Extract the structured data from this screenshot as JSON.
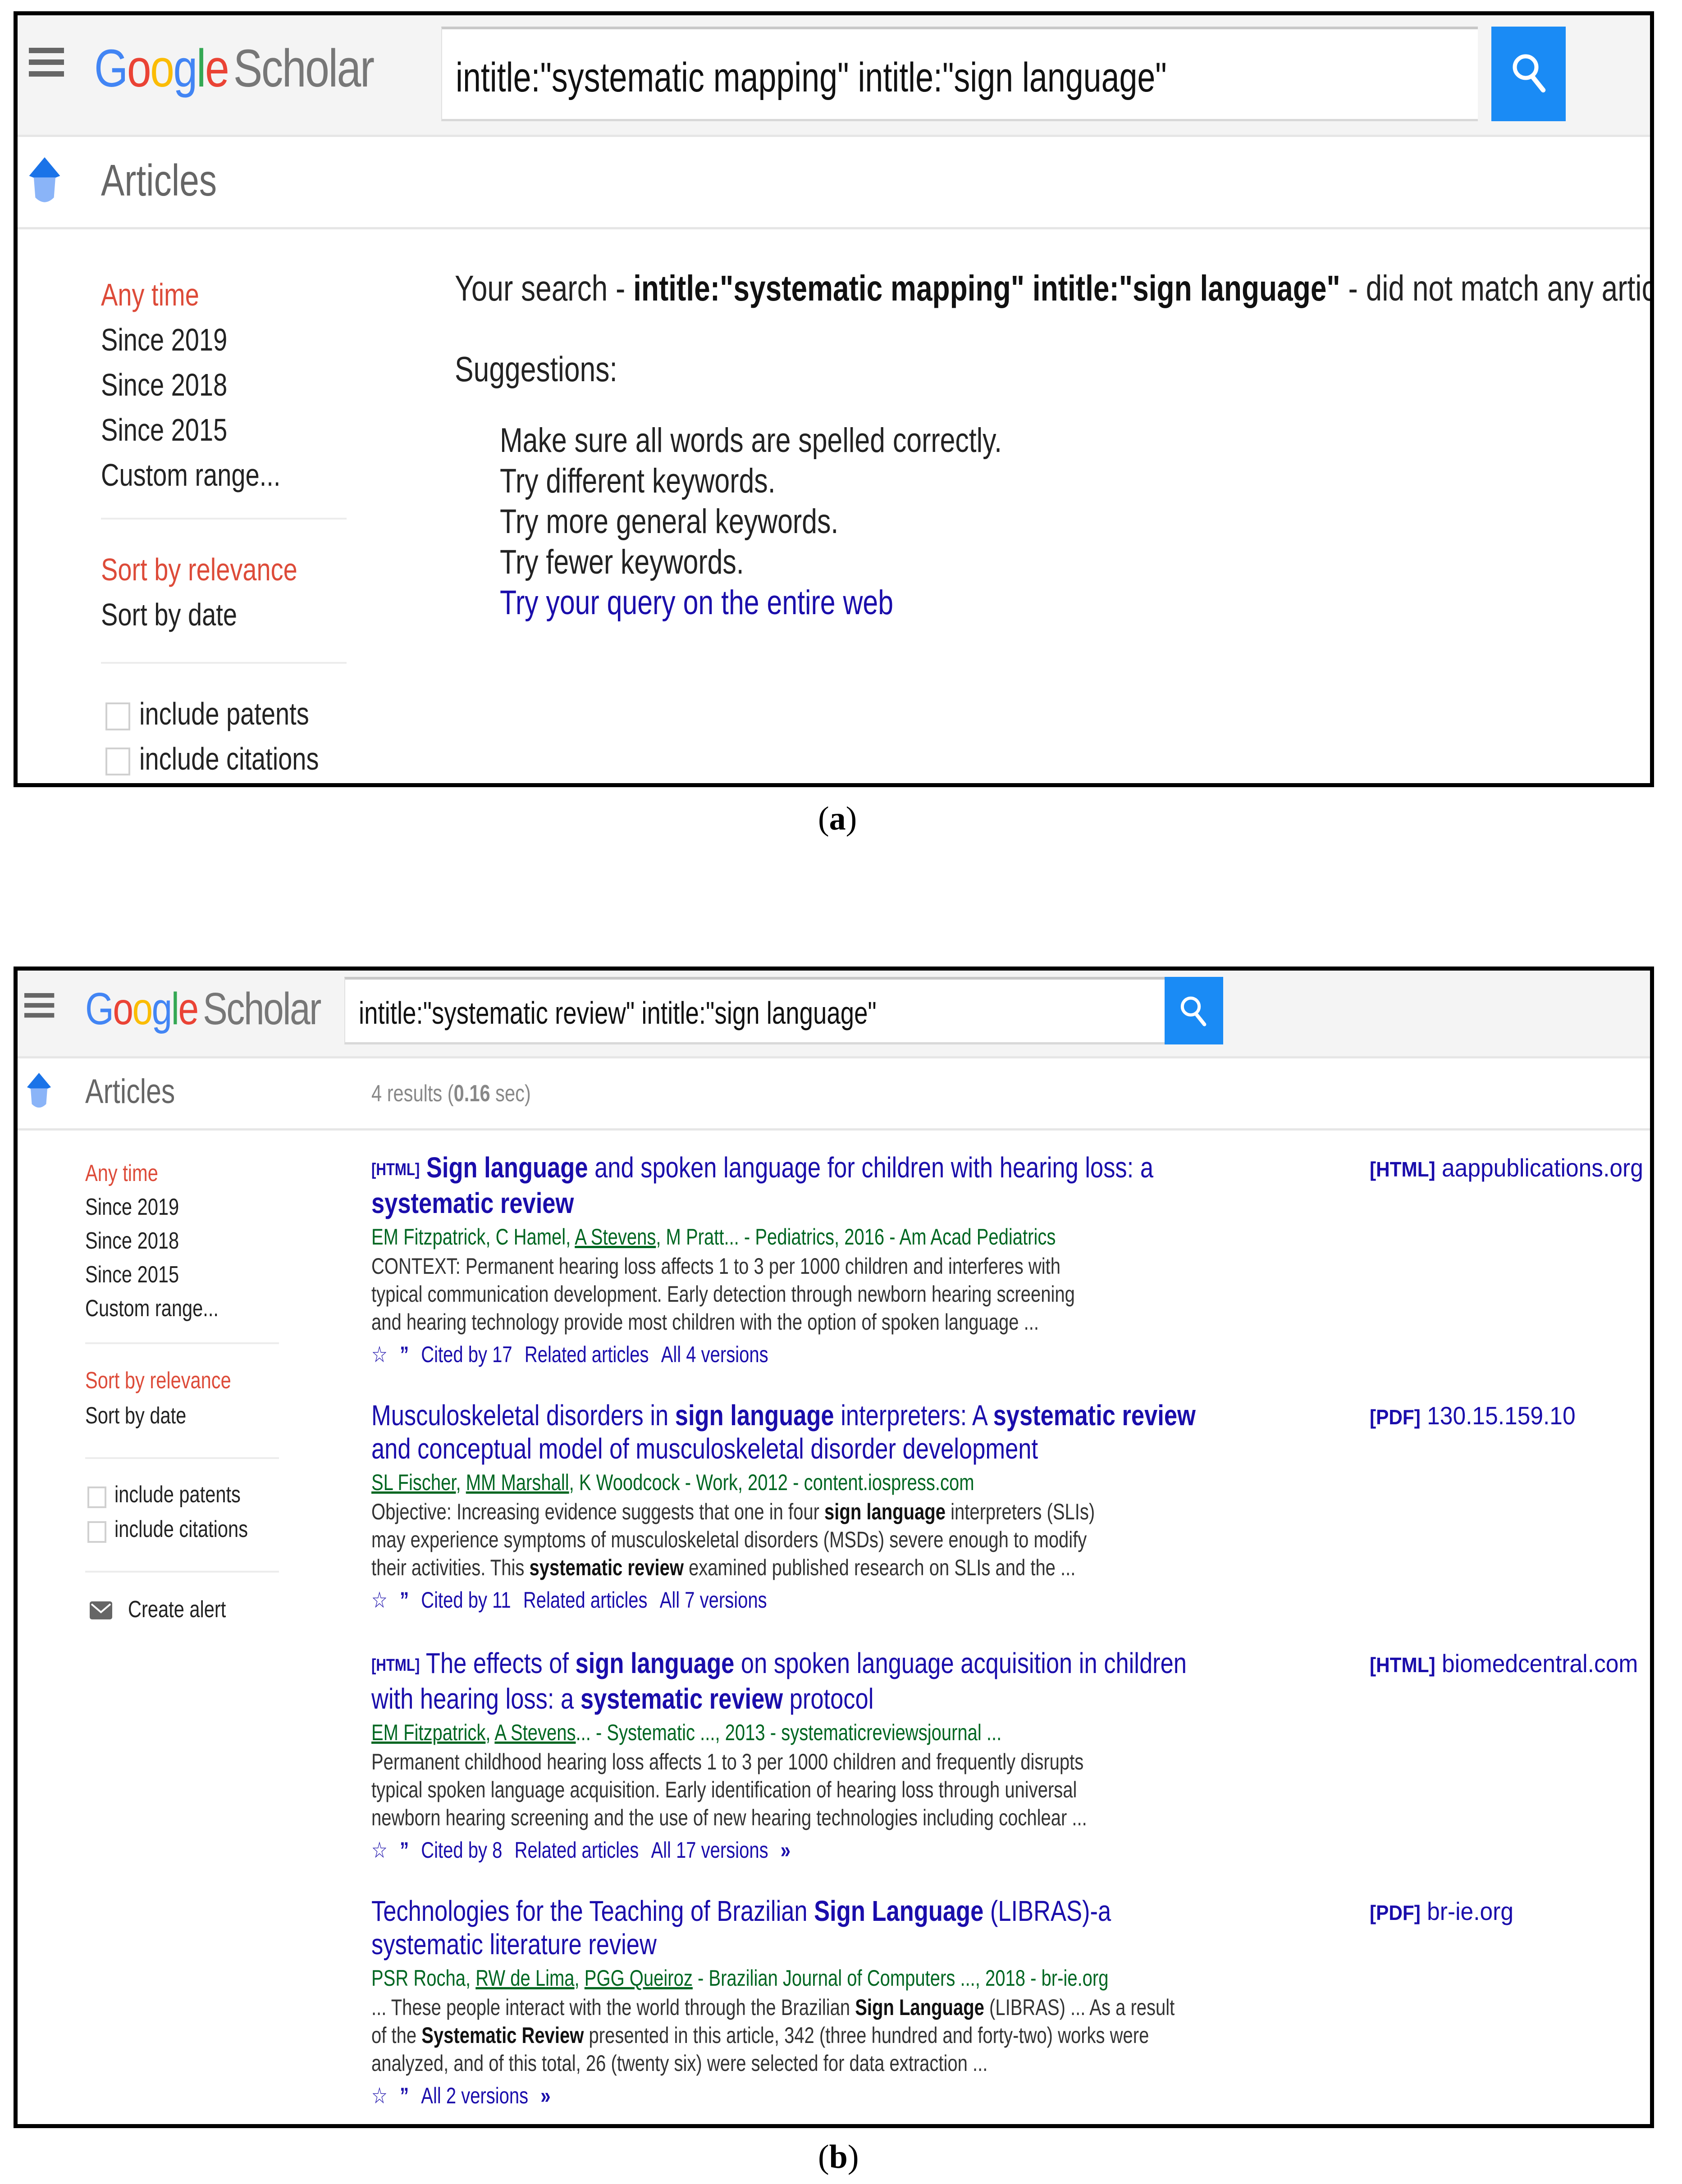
{
  "panel_a": {
    "logo": {
      "google": [
        "G",
        "o",
        "o",
        "g",
        "l",
        "e"
      ],
      "product": "Scholar"
    },
    "search": {
      "query": "intitle:\"systematic mapping\" intitle:\"sign language\""
    },
    "articles_label": "Articles",
    "sidebar": {
      "time_filters": [
        {
          "label": "Any time",
          "active": true
        },
        {
          "label": "Since 2019",
          "active": false
        },
        {
          "label": "Since 2018",
          "active": false
        },
        {
          "label": "Since 2015",
          "active": false
        },
        {
          "label": "Custom range...",
          "active": false
        }
      ],
      "sort_options": [
        {
          "label": "Sort by relevance",
          "active": true
        },
        {
          "label": "Sort by date",
          "active": false
        }
      ],
      "checkboxes": [
        {
          "label": "include patents",
          "checked": false
        },
        {
          "label": "include citations",
          "checked": false
        }
      ]
    },
    "message": {
      "prefix": "Your search - ",
      "query": "intitle:\"systematic mapping\" intitle:\"sign language\"",
      "suffix": " - did not match any articles."
    },
    "suggestions_title": "Suggestions:",
    "suggestions": [
      "Make sure all words are spelled correctly.",
      "Try different keywords.",
      "Try more general keywords.",
      "Try fewer keywords."
    ],
    "web_link": "Try your query on the entire web",
    "caption": "a"
  },
  "panel_b": {
    "logo": {
      "google": [
        "G",
        "o",
        "o",
        "g",
        "l",
        "e"
      ],
      "product": "Scholar"
    },
    "search": {
      "query": "intitle:\"systematic review\" intitle:\"sign language\""
    },
    "articles_label": "Articles",
    "results_count": {
      "prefix": "4 results (",
      "time": "0.16",
      "suffix": " sec)"
    },
    "sidebar": {
      "time_filters": [
        {
          "label": "Any time",
          "active": true
        },
        {
          "label": "Since 2019",
          "active": false
        },
        {
          "label": "Since 2018",
          "active": false
        },
        {
          "label": "Since 2015",
          "active": false
        },
        {
          "label": "Custom range...",
          "active": false
        }
      ],
      "sort_options": [
        {
          "label": "Sort by relevance",
          "active": true
        },
        {
          "label": "Sort by date",
          "active": false
        }
      ],
      "checkboxes": [
        {
          "label": "include patents",
          "checked": false
        },
        {
          "label": "include citations",
          "checked": false
        }
      ],
      "create_alert": "Create alert"
    },
    "results": [
      {
        "tag": "[HTML]",
        "title_lines": [
          [
            {
              "t": "Sign language",
              "b": true
            },
            {
              "t": " and spoken language for children with hearing loss: a",
              "b": false
            }
          ],
          [
            {
              "t": "systematic review",
              "b": true
            }
          ]
        ],
        "authors": [
          {
            "t": "EM Fitzpatrick, C Hamel, ",
            "u": false
          },
          {
            "t": "A Stevens",
            "u": true
          },
          {
            "t": ", M Pratt... - Pediatrics, 2016 - Am Acad Pediatrics",
            "u": false
          }
        ],
        "snippet_lines": [
          [
            {
              "t": "CONTEXT: Permanent hearing loss affects 1 to 3 per 1000 children and interferes with",
              "b": false
            }
          ],
          [
            {
              "t": "typical communication development. Early detection through newborn hearing screening",
              "b": false
            }
          ],
          [
            {
              "t": "and hearing technology provide most children with the option of spoken language ...",
              "b": false
            }
          ]
        ],
        "actions": [
          "Cited by 17",
          "Related articles",
          "All 4 versions"
        ],
        "has_more": false,
        "side_tag": "[HTML]",
        "side_domain": "aappublications.org"
      },
      {
        "tag": "",
        "title_lines": [
          [
            {
              "t": "Musculoskeletal disorders in ",
              "b": false
            },
            {
              "t": "sign language",
              "b": true
            },
            {
              "t": " interpreters: A ",
              "b": false
            },
            {
              "t": "systematic review",
              "b": true
            }
          ],
          [
            {
              "t": "and conceptual model of musculoskeletal disorder development",
              "b": false
            }
          ]
        ],
        "authors": [
          {
            "t": "SL Fischer",
            "u": true
          },
          {
            "t": ", ",
            "u": false
          },
          {
            "t": "MM Marshall",
            "u": true
          },
          {
            "t": ", K Woodcock - Work, 2012 - content.iospress.com",
            "u": false
          }
        ],
        "snippet_lines": [
          [
            {
              "t": "Objective: Increasing evidence suggests that one in four ",
              "b": false
            },
            {
              "t": "sign language",
              "b": true
            },
            {
              "t": " interpreters (SLIs)",
              "b": false
            }
          ],
          [
            {
              "t": "may experience symptoms of musculoskeletal disorders (MSDs) severe enough to modify",
              "b": false
            }
          ],
          [
            {
              "t": "their activities. This ",
              "b": false
            },
            {
              "t": "systematic review",
              "b": true
            },
            {
              "t": " examined published research on SLIs and the ...",
              "b": false
            }
          ]
        ],
        "actions": [
          "Cited by 11",
          "Related articles",
          "All 7 versions"
        ],
        "has_more": false,
        "side_tag": "[PDF]",
        "side_domain": "130.15.159.10"
      },
      {
        "tag": "[HTML]",
        "title_lines": [
          [
            {
              "t": "The effects of ",
              "b": false
            },
            {
              "t": "sign language",
              "b": true
            },
            {
              "t": " on spoken language acquisition in children",
              "b": false
            }
          ],
          [
            {
              "t": "with hearing loss: a ",
              "b": false
            },
            {
              "t": "systematic review",
              "b": true
            },
            {
              "t": " protocol",
              "b": false
            }
          ]
        ],
        "authors": [
          {
            "t": "EM Fitzpatrick",
            "u": true
          },
          {
            "t": ", ",
            "u": false
          },
          {
            "t": "A Stevens",
            "u": true
          },
          {
            "t": "... - Systematic ..., 2013 - systematicreviewsjournal ...",
            "u": false
          }
        ],
        "snippet_lines": [
          [
            {
              "t": "Permanent childhood hearing loss affects 1 to 3 per 1000 children and frequently disrupts",
              "b": false
            }
          ],
          [
            {
              "t": "typical spoken language acquisition. Early identification of hearing loss through universal",
              "b": false
            }
          ],
          [
            {
              "t": "newborn hearing screening and the use of new hearing technologies including cochlear ...",
              "b": false
            }
          ]
        ],
        "actions": [
          "Cited by 8",
          "Related articles",
          "All 17 versions"
        ],
        "has_more": true,
        "side_tag": "[HTML]",
        "side_domain": "biomedcentral.com"
      },
      {
        "tag": "",
        "title_lines": [
          [
            {
              "t": "Technologies for the Teaching of Brazilian ",
              "b": false
            },
            {
              "t": "Sign Language",
              "b": true
            },
            {
              "t": " (LIBRAS)-a",
              "b": false
            }
          ],
          [
            {
              "t": "systematic literature review",
              "b": false
            }
          ]
        ],
        "authors": [
          {
            "t": "PSR Rocha, ",
            "u": false
          },
          {
            "t": "RW de Lima",
            "u": true
          },
          {
            "t": ", ",
            "u": false
          },
          {
            "t": "PGG Queiroz",
            "u": true
          },
          {
            "t": " - Brazilian Journal of Computers ..., 2018 - br-ie.org",
            "u": false
          }
        ],
        "snippet_lines": [
          [
            {
              "t": "... These people interact with the world through the Brazilian ",
              "b": false
            },
            {
              "t": "Sign Language",
              "b": true
            },
            {
              "t": " (LIBRAS) ... As a result",
              "b": false
            }
          ],
          [
            {
              "t": "of the ",
              "b": false
            },
            {
              "t": "Systematic Review",
              "b": true
            },
            {
              "t": " presented in this article, 342 (three hundred and forty-two) works were",
              "b": false
            }
          ],
          [
            {
              "t": "analyzed, and of this total, 26 (twenty six) were selected for data extraction ...",
              "b": false
            }
          ]
        ],
        "actions": [
          "All 2 versions"
        ],
        "has_more": true,
        "side_tag": "[PDF]",
        "side_domain": "br-ie.org"
      }
    ],
    "caption": "b"
  },
  "colors": {
    "link": "#1a0dab",
    "active_filter": "#dd4b39",
    "author_green": "#006621",
    "search_button": "#1a8bf5",
    "header_bg": "#f4f4f4"
  },
  "icons": {
    "menu": "hamburger-menu-icon",
    "search": "magnifier-icon",
    "articles": "scholar-cap-icon",
    "save": "star-icon",
    "cite": "quote-icon",
    "more": "double-chevron-icon",
    "alert": "envelope-icon"
  }
}
